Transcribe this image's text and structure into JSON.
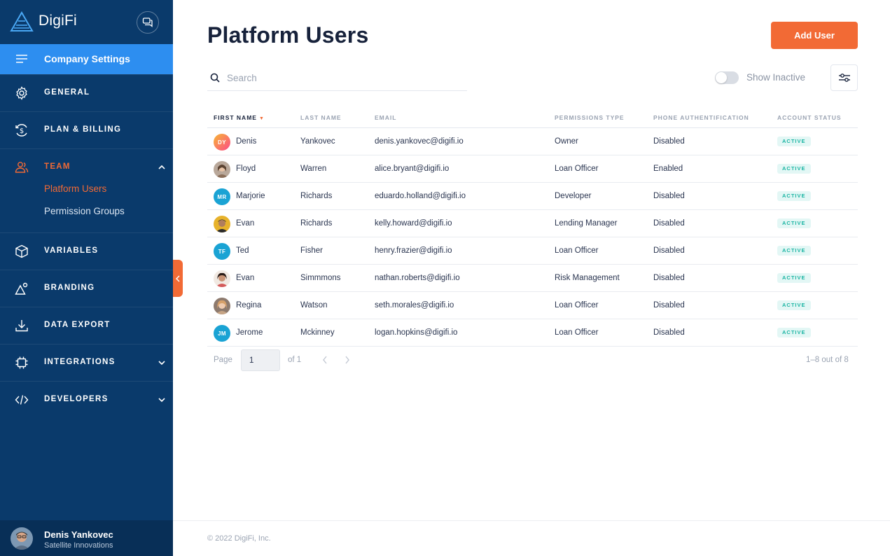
{
  "brand": {
    "name": "DigiFi"
  },
  "sidebar": {
    "company_settings": "Company Settings",
    "items": [
      {
        "label": "GENERAL"
      },
      {
        "label": "PLAN & BILLING"
      },
      {
        "label": "TEAM"
      },
      {
        "label": "VARIABLES"
      },
      {
        "label": "BRANDING"
      },
      {
        "label": "DATA EXPORT"
      },
      {
        "label": "INTEGRATIONS"
      },
      {
        "label": "DEVELOPERS"
      }
    ],
    "team_sub": [
      {
        "label": "Platform Users"
      },
      {
        "label": "Permission Groups"
      }
    ]
  },
  "current_user": {
    "name": "Denis Yankovec",
    "org": "Satellite Innovations"
  },
  "main": {
    "title": "Platform Users",
    "add_button": "Add User",
    "search_placeholder": "Search",
    "show_inactive": "Show Inactive"
  },
  "table": {
    "columns": [
      "FIRST NAME",
      "LAST NAME",
      "EMAIL",
      "PERMISSIONS TYPE",
      "PHONE AUTHENTIFICATION",
      "ACCOUNT STATUS"
    ],
    "rows": [
      {
        "initials": "DY",
        "first": "Denis",
        "last": "Yankovec",
        "email": "denis.yankovec@digifi.io",
        "perm": "Owner",
        "phone": "Disabled",
        "status": "ACTIVE"
      },
      {
        "initials": "",
        "first": "Floyd",
        "last": "Warren",
        "email": "alice.bryant@digifi.io",
        "perm": "Loan Officer",
        "phone": "Enabled",
        "status": "ACTIVE"
      },
      {
        "initials": "MR",
        "first": "Marjorie",
        "last": "Richards",
        "email": "eduardo.holland@digifi.io",
        "perm": "Developer",
        "phone": "Disabled",
        "status": "ACTIVE"
      },
      {
        "initials": "",
        "first": "Evan",
        "last": "Richards",
        "email": "kelly.howard@digifi.io",
        "perm": "Lending Manager",
        "phone": "Disabled",
        "status": "ACTIVE"
      },
      {
        "initials": "TF",
        "first": "Ted",
        "last": "Fisher",
        "email": "henry.frazier@digifi.io",
        "perm": "Loan Officer",
        "phone": "Disabled",
        "status": "ACTIVE"
      },
      {
        "initials": "",
        "first": "Evan",
        "last": "Simmmons",
        "email": "nathan.roberts@digifi.io",
        "perm": "Risk Management",
        "phone": "Disabled",
        "status": "ACTIVE"
      },
      {
        "initials": "",
        "first": "Regina",
        "last": "Watson",
        "email": "seth.morales@digifi.io",
        "perm": "Loan Officer",
        "phone": "Disabled",
        "status": "ACTIVE"
      },
      {
        "initials": "JM",
        "first": "Jerome",
        "last": "Mckinney",
        "email": "logan.hopkins@digifi.io",
        "perm": "Loan Officer",
        "phone": "Disabled",
        "status": "ACTIVE"
      }
    ]
  },
  "pagination": {
    "page_label": "Page",
    "page_value": "1",
    "of_label": "of 1",
    "summary": "1–8 out of 8"
  },
  "footer": {
    "copyright": "© 2022 DigiFi, Inc."
  },
  "colors": {
    "sidebar": "#0a3a6b",
    "active_blue": "#2d8ef0",
    "accent": "#f26a35",
    "status_badge": "#1cb5a3"
  }
}
